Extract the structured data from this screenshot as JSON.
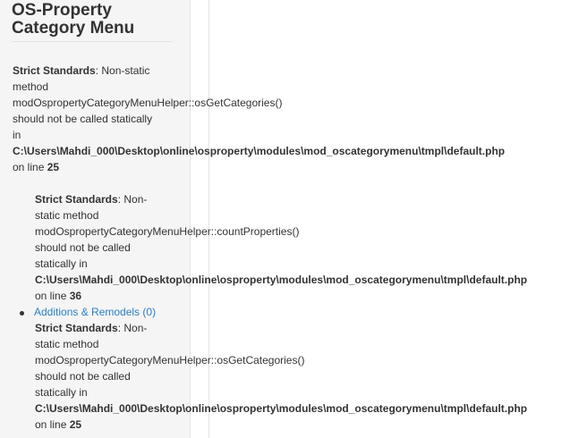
{
  "module": {
    "title_line1": "OS-Property",
    "title_line2": "Category Menu"
  },
  "notices": [
    {
      "label": "Strict Standards",
      "sep": ":",
      "lines": [
        "Non-static",
        "method",
        "modOspropertyCategoryMenuHelper::osGetCategories()",
        "should not be called statically",
        "in"
      ],
      "path": "C:\\Users\\Mahdi_000\\Desktop\\online\\osproperty\\modules\\mod_oscategorymenu\\tmpl\\default.php",
      "line_prefix": "on line",
      "line_number": "25"
    },
    {
      "label": "Strict Standards",
      "sep": ":",
      "lines": [
        "Non-",
        "static method",
        "modOspropertyCategoryMenuHelper::countProperties()",
        "should not be called",
        "statically in"
      ],
      "path": "C:\\Users\\Mahdi_000\\Desktop\\online\\osproperty\\modules\\mod_oscategorymenu\\tmpl\\default.php",
      "line_prefix": "on line",
      "line_number": "36"
    },
    {
      "label": "Strict Standards",
      "sep": ":",
      "lines": [
        "Non-",
        "static method",
        "modOspropertyCategoryMenuHelper::osGetCategories()",
        "should not be called",
        "statically in"
      ],
      "path": "C:\\Users\\Mahdi_000\\Desktop\\online\\osproperty\\modules\\mod_oscategorymenu\\tmpl\\default.php",
      "line_prefix": "on line",
      "line_number": "25"
    }
  ],
  "categories": [
    {
      "label": "Additions & Remodels (0)"
    }
  ],
  "colors": {
    "link": "#2a80c5",
    "text": "#333333",
    "sidebar_bg": "#f5f5f5"
  }
}
